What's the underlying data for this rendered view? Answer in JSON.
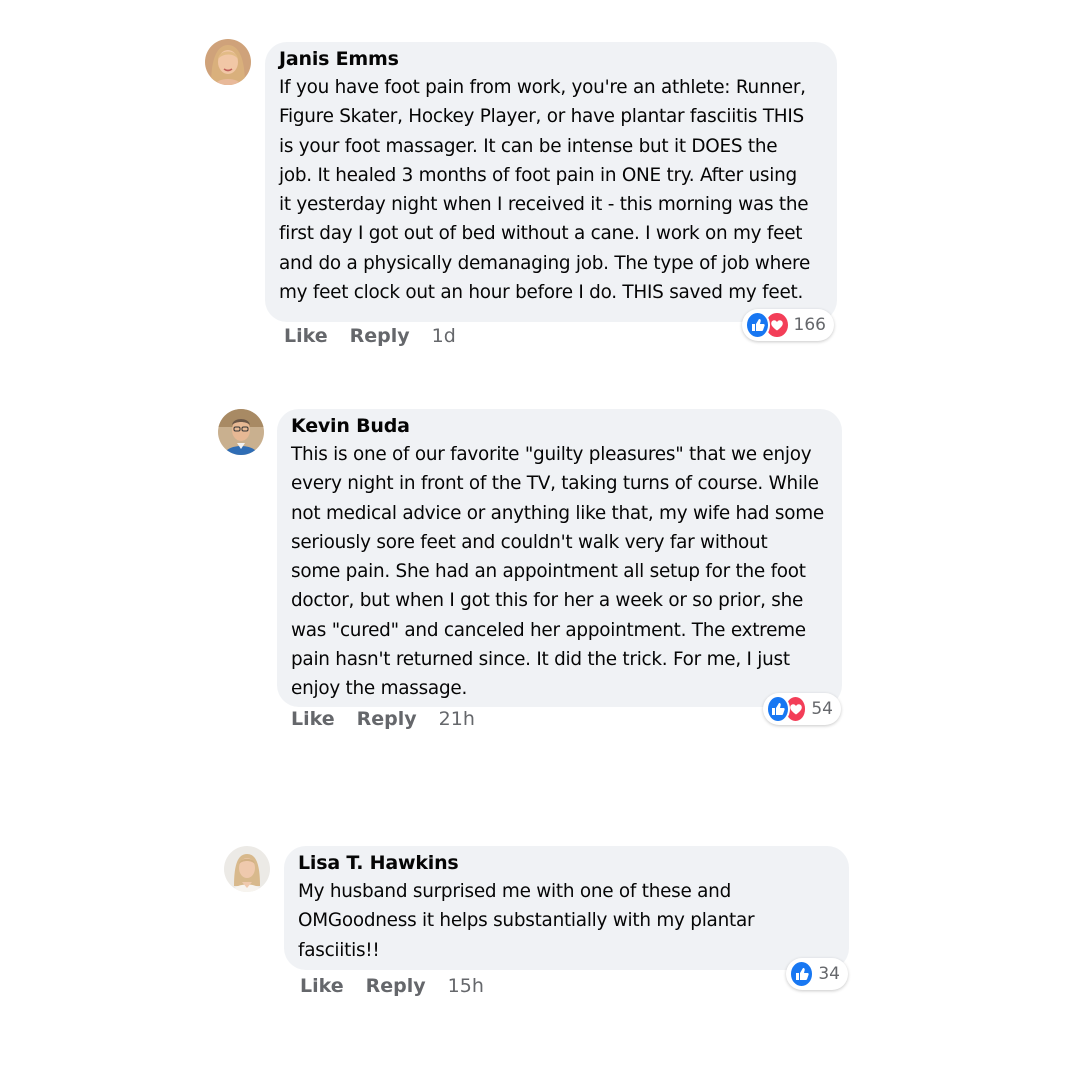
{
  "comments": [
    {
      "author": "Janis Emms",
      "text": "If you have foot pain from work, you're an athlete: Runner,\nFigure Skater, Hockey Player, or have plantar fasciitis THIS\nis your foot massager. It can be intense but it DOES the\njob. It healed 3 months of foot pain in ONE try. After using\nit yesterday night when I received it - this morning was the\nfirst day I got out of bed without a cane. I work on my feet\nand do a physically demanaging job. The type of job where\nmy feet clock out an hour before I do. THIS saved my feet.",
      "like_label": "Like",
      "reply_label": "Reply",
      "time": "1d",
      "reaction_count": "166",
      "reactions": [
        "like-icon",
        "love-icon"
      ]
    },
    {
      "author": "Kevin Buda",
      "text": "This is one of our favorite \"guilty pleasures\" that we enjoy\nevery night in front of the TV, taking turns of course. While\nnot medical advice or anything like that, my wife had some\nseriously sore feet and couldn't walk very far without\nsome pain. She had an appointment all setup for the foot\ndoctor, but when I got this for her a week or so prior, she\nwas \"cured\" and canceled her appointment. The extreme\npain hasn't returned since. It did the trick. For me, I just\nenjoy the massage.",
      "like_label": "Like",
      "reply_label": "Reply",
      "time": "21h",
      "reaction_count": "54",
      "reactions": [
        "like-icon",
        "love-icon"
      ]
    },
    {
      "author": "Lisa T. Hawkins",
      "text": "My husband surprised me with one of these and\nOMGoodness it helps substantially with my plantar\nfasciitis!!",
      "like_label": "Like",
      "reply_label": "Reply",
      "time": "15h",
      "reaction_count": "34",
      "reactions": [
        "like-icon"
      ]
    }
  ],
  "colors": {
    "bubble": "#f0f2f5",
    "meta_text": "#65676b",
    "like_blue": "#1877f2",
    "love_red": "#f33e58"
  }
}
